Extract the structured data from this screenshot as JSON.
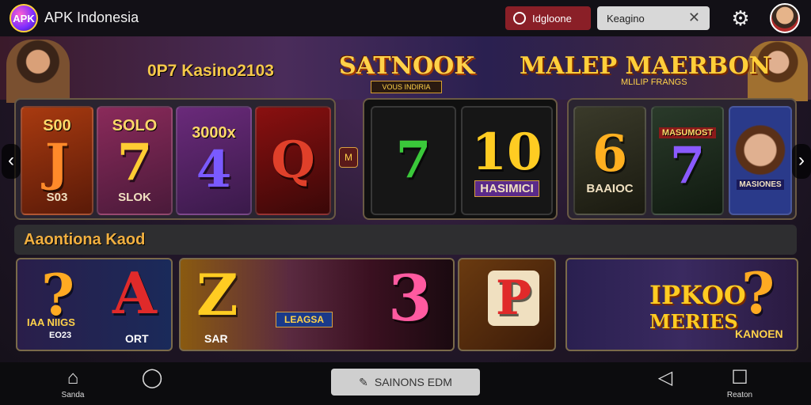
{
  "header": {
    "logo_text": "APK",
    "app_title": "APK Indonesia",
    "chip_label": "Idgloone",
    "search_value": "Keagino"
  },
  "banner": {
    "subtitle": "0P7 Kasino2103",
    "center_logo": "SATNOOK",
    "center_logo_sub": "VOUS INDIRIA",
    "right_title": "MALEP MAERBON",
    "right_sub": "MLILIP FRANGS"
  },
  "reels": {
    "panel1": [
      {
        "top": "S00",
        "big": "J",
        "bottom": "S03",
        "color": "#ff8a2a"
      },
      {
        "top": "SOLO",
        "big": "7",
        "bottom": "SLOK",
        "color": "#ffcc33"
      },
      {
        "top": "3000x",
        "big": "4",
        "bottom": "",
        "color": "#7a5aff"
      },
      {
        "top": "",
        "big": "Q",
        "bottom": "",
        "color": "#e0402a"
      }
    ],
    "divider_label": "M",
    "panel2": [
      {
        "top": "",
        "big": "7",
        "bottom": "",
        "color": "#3ac83a"
      },
      {
        "top": "",
        "big": "10",
        "bottom": "HASIMICI",
        "color": "#ffcc22"
      }
    ],
    "panel3": [
      {
        "top": "",
        "big": "6",
        "bottom": "BAAIOC",
        "color": "#ffb020"
      },
      {
        "top": "MASUMOST",
        "big": "7",
        "bottom": "",
        "color": "#8a5aff"
      },
      {
        "top": "",
        "big": "",
        "bottom": "MASIONES",
        "color": "#f0c0a0"
      }
    ]
  },
  "section": {
    "title": "Aaontiona Kaod"
  },
  "cards": {
    "c1": {
      "glyph_a": "?",
      "label_a": "IAA NIIGS",
      "label_a2": "EO23",
      "glyph_b": "A",
      "label_b": "ORT"
    },
    "c2": {
      "glyph_a": "Z",
      "label_a": "SAR",
      "banner": "LEAGSA",
      "glyph_b": "3"
    },
    "c3": {
      "glyph": "P"
    },
    "c4": {
      "title_a": "IPKOO",
      "title_b": "MERIES",
      "glyph": "?",
      "label": "KANOEN"
    }
  },
  "navbar": {
    "home_label": "Sanda",
    "center_label": "SAINONS EDM",
    "menu_label": "Reaton"
  }
}
